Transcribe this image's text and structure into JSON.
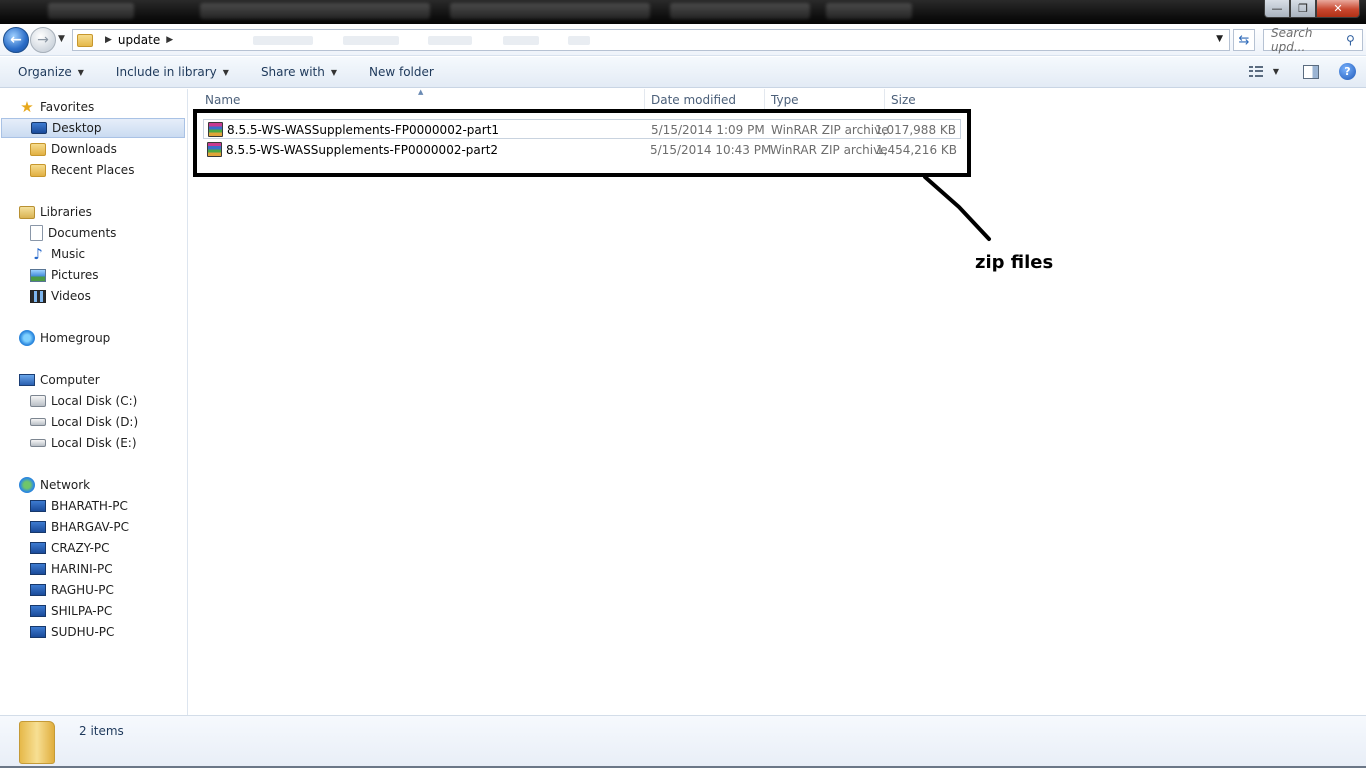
{
  "window": {
    "buttons": {
      "minimize": "—",
      "maximize": "❐",
      "close": "✕"
    }
  },
  "address": {
    "crumbs": [
      "update"
    ],
    "search_placeholder": "Search upd..."
  },
  "toolbar": {
    "commands": [
      "Organize",
      "Include in library",
      "Share with",
      "New folder"
    ]
  },
  "nav": {
    "favorites": {
      "label": "Favorites",
      "items": [
        "Desktop",
        "Downloads",
        "Recent Places"
      ]
    },
    "libraries": {
      "label": "Libraries",
      "items": [
        "Documents",
        "Music",
        "Pictures",
        "Videos"
      ]
    },
    "homegroup": {
      "label": "Homegroup"
    },
    "computer": {
      "label": "Computer",
      "items": [
        "Local Disk (C:)",
        "Local Disk (D:)",
        "Local Disk (E:)"
      ]
    },
    "network": {
      "label": "Network",
      "items": [
        "BHARATH-PC",
        "BHARGAV-PC",
        "CRAZY-PC",
        "HARINI-PC",
        "RAGHU-PC",
        "SHILPA-PC",
        "SUDHU-PC"
      ]
    }
  },
  "files": {
    "columns": [
      "Name",
      "Date modified",
      "Type",
      "Size"
    ],
    "rows": [
      {
        "name": "8.5.5-WS-WASSupplements-FP0000002-part1",
        "date": "5/15/2014 1:09 PM",
        "type": "WinRAR ZIP archive",
        "size": "1,017,988 KB"
      },
      {
        "name": "8.5.5-WS-WASSupplements-FP0000002-part2",
        "date": "5/15/2014 10:43 PM",
        "type": "WinRAR ZIP archive",
        "size": "1,454,216 KB"
      }
    ]
  },
  "annotation": {
    "label": "zip files"
  },
  "details": {
    "count": "2 items"
  }
}
